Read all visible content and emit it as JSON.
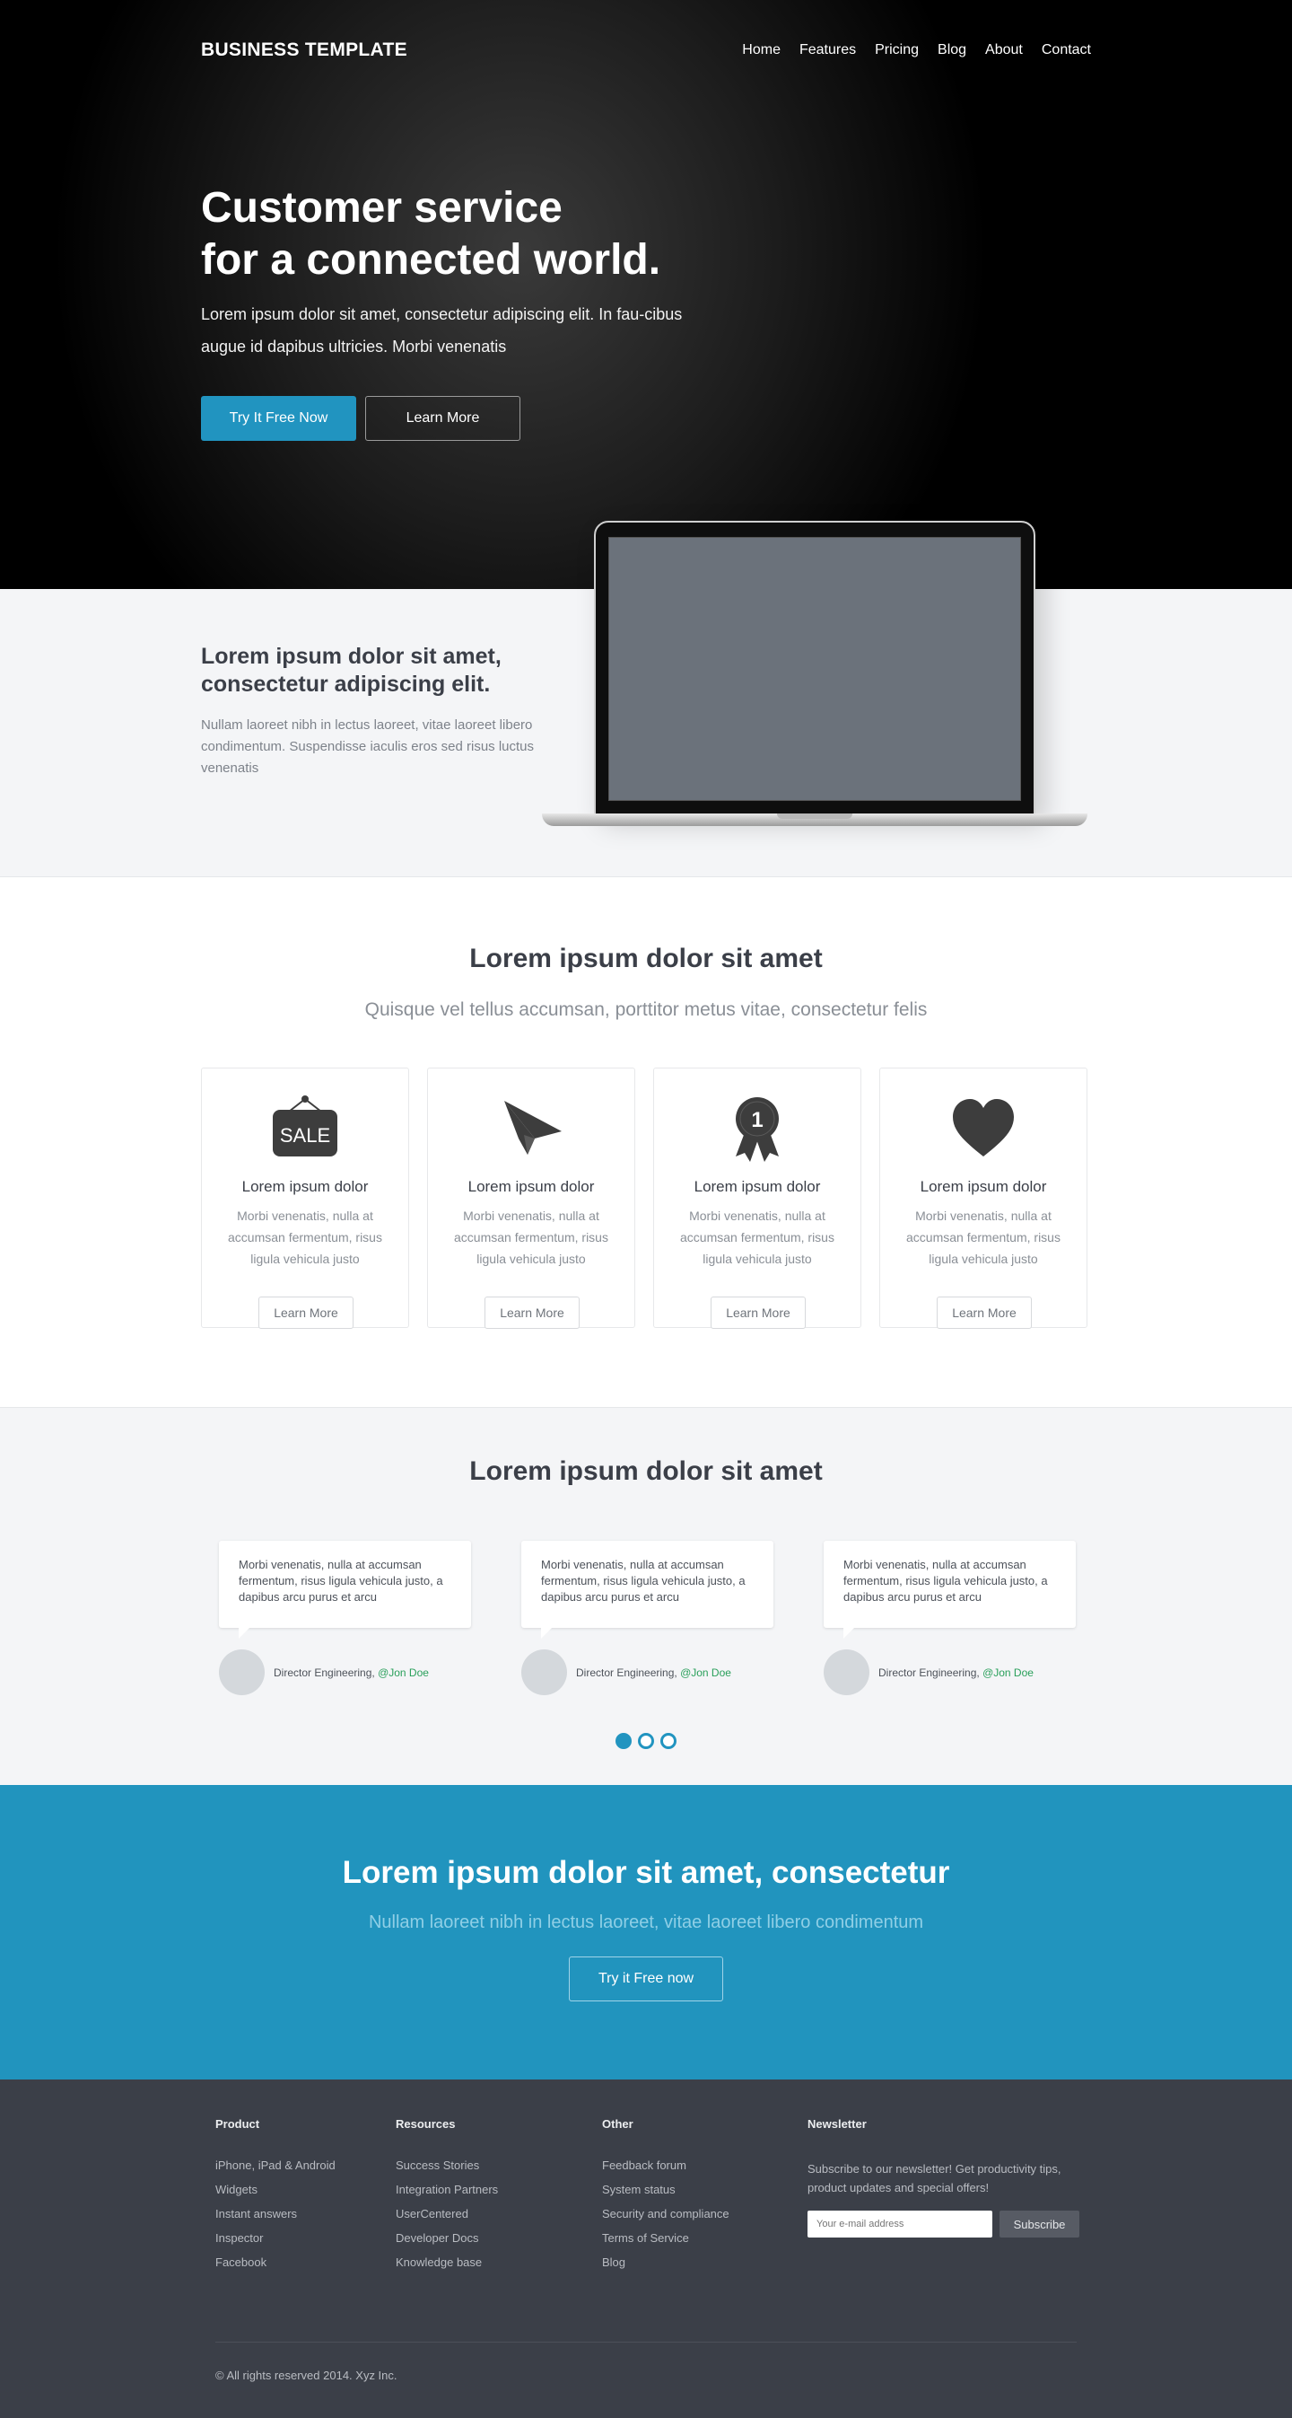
{
  "nav": {
    "brand": "BUSINESS TEMPLATE",
    "items": [
      "Home",
      "Features",
      "Pricing",
      "Blog",
      "About",
      "Contact"
    ]
  },
  "hero": {
    "title_line1": "Customer service",
    "title_line2": "for a connected world.",
    "text": "Lorem ipsum dolor sit amet, consectetur adipiscing elit. In fau-cibus augue id dapibus ultricies. Morbi venenatis",
    "primary_button": "Try It Free Now",
    "secondary_button": "Learn More"
  },
  "intro": {
    "title": "Lorem ipsum dolor sit amet, consectetur adipiscing elit.",
    "text": "Nullam laoreet nibh in lectus laoreet, vitae laoreet libero condimentum. Suspendisse iaculis eros sed risus luctus venenatis"
  },
  "features": {
    "title": "Lorem ipsum dolor sit amet",
    "subtitle": "Quisque vel tellus accumsan, porttitor metus vitae, consectetur felis",
    "cards": [
      {
        "icon": "sale-tag-icon",
        "icon_text": "SALE",
        "title": "Lorem ipsum dolor",
        "text": "Morbi venenatis, nulla at accumsan fermentum, risus ligula vehicula justo",
        "button": "Learn More"
      },
      {
        "icon": "paper-plane-icon",
        "title": "Lorem ipsum dolor",
        "text": "Morbi venenatis, nulla at accumsan fermentum, risus ligula vehicula justo",
        "button": "Learn More"
      },
      {
        "icon": "award-ribbon-icon",
        "icon_text": "1",
        "title": "Lorem ipsum dolor",
        "text": "Morbi venenatis, nulla at accumsan fermentum, risus ligula vehicula justo",
        "button": "Learn More"
      },
      {
        "icon": "heart-icon",
        "title": "Lorem ipsum dolor",
        "text": "Morbi venenatis, nulla at accumsan fermentum, risus ligula vehicula justo",
        "button": "Learn More"
      }
    ]
  },
  "testimonials": {
    "title": "Lorem ipsum dolor sit amet",
    "items": [
      {
        "quote": "Morbi venenatis, nulla at accumsan fermentum, risus ligula vehicula justo, a dapibus arcu purus et arcu",
        "role": "Director Engineering, ",
        "handle": "@Jon Doe"
      },
      {
        "quote": "Morbi venenatis, nulla at accumsan fermentum, risus ligula vehicula justo, a dapibus arcu purus et arcu",
        "role": "Director Engineering, ",
        "handle": "@Jon Doe"
      },
      {
        "quote": "Morbi venenatis, nulla at accumsan fermentum, risus ligula vehicula justo, a dapibus arcu purus et arcu",
        "role": "Director Engineering, ",
        "handle": "@Jon Doe"
      }
    ],
    "active_slide": 1,
    "slide_count": 3
  },
  "cta": {
    "title": "Lorem ipsum dolor sit amet, consectetur",
    "subtitle": "Nullam laoreet nibh in lectus laoreet, vitae laoreet libero condimentum",
    "button": "Try it Free now"
  },
  "footer": {
    "product": {
      "heading": "Product",
      "links": [
        "iPhone, iPad & Android",
        "Widgets",
        "Instant answers",
        "Inspector",
        "Facebook"
      ]
    },
    "resources": {
      "heading": "Resources",
      "links": [
        "Success Stories",
        "Integration Partners",
        "UserCentered",
        "Developer Docs",
        "Knowledge base"
      ]
    },
    "other": {
      "heading": "Other",
      "links": [
        "Feedback forum",
        "System status",
        "Security and compliance",
        "Terms of Service",
        "Blog"
      ]
    },
    "newsletter": {
      "heading": "Newsletter",
      "text": "Subscribe to our newsletter! Get productivity tips, product updates and special offers!",
      "placeholder": "Your e-mail address",
      "button": "Subscribe"
    },
    "copyright": "© All rights reserved 2014. Xyz Inc."
  },
  "colors": {
    "accent": "#2194c0",
    "footer_bg": "#3b3f48",
    "handle_green": "#2aa05b"
  }
}
